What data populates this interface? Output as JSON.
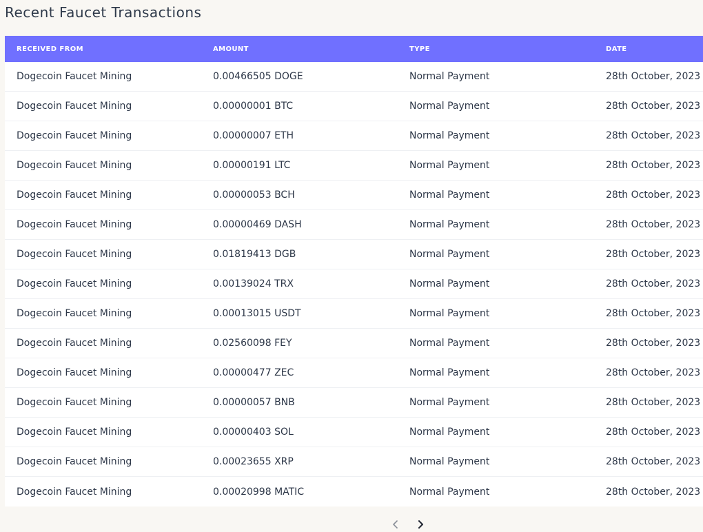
{
  "page": {
    "title": "Recent Faucet Transactions"
  },
  "table": {
    "headers": [
      "RECEIVED FROM",
      "AMOUNT",
      "TYPE",
      "DATE"
    ],
    "rows": [
      [
        "Dogecoin Faucet Mining",
        "0.00466505 DOGE",
        "Normal Payment",
        "28th October, 2023"
      ],
      [
        "Dogecoin Faucet Mining",
        "0.00000001 BTC",
        "Normal Payment",
        "28th October, 2023"
      ],
      [
        "Dogecoin Faucet Mining",
        "0.00000007 ETH",
        "Normal Payment",
        "28th October, 2023"
      ],
      [
        "Dogecoin Faucet Mining",
        "0.00000191 LTC",
        "Normal Payment",
        "28th October, 2023"
      ],
      [
        "Dogecoin Faucet Mining",
        "0.00000053 BCH",
        "Normal Payment",
        "28th October, 2023"
      ],
      [
        "Dogecoin Faucet Mining",
        "0.00000469 DASH",
        "Normal Payment",
        "28th October, 2023"
      ],
      [
        "Dogecoin Faucet Mining",
        "0.01819413 DGB",
        "Normal Payment",
        "28th October, 2023"
      ],
      [
        "Dogecoin Faucet Mining",
        "0.00139024 TRX",
        "Normal Payment",
        "28th October, 2023"
      ],
      [
        "Dogecoin Faucet Mining",
        "0.00013015 USDT",
        "Normal Payment",
        "28th October, 2023"
      ],
      [
        "Dogecoin Faucet Mining",
        "0.02560098 FEY",
        "Normal Payment",
        "28th October, 2023"
      ],
      [
        "Dogecoin Faucet Mining",
        "0.00000477 ZEC",
        "Normal Payment",
        "28th October, 2023"
      ],
      [
        "Dogecoin Faucet Mining",
        "0.00000057 BNB",
        "Normal Payment",
        "28th October, 2023"
      ],
      [
        "Dogecoin Faucet Mining",
        "0.00000403 SOL",
        "Normal Payment",
        "28th October, 2023"
      ],
      [
        "Dogecoin Faucet Mining",
        "0.00023655 XRP",
        "Normal Payment",
        "28th October, 2023"
      ],
      [
        "Dogecoin Faucet Mining",
        "0.00020998 MATIC",
        "Normal Payment",
        "28th October, 2023"
      ]
    ]
  },
  "pagination": {
    "prev_icon": "chevron-left-icon",
    "next_icon": "chevron-right-icon"
  },
  "colors": {
    "header_bg": "#7070ff",
    "page_bg": "#f9f7f3",
    "text": "#2d3748"
  }
}
